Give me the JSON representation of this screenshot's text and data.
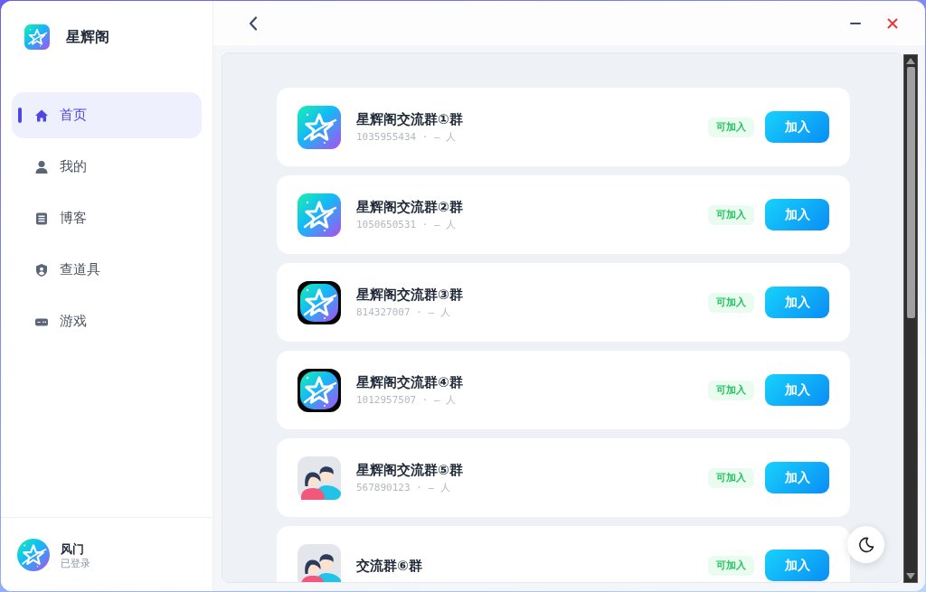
{
  "app": {
    "title": "星辉阁"
  },
  "nav": [
    {
      "label": "首页",
      "kind": "home",
      "selected": true
    },
    {
      "label": "我的",
      "kind": "person",
      "selected": false
    },
    {
      "label": "博客",
      "kind": "document",
      "selected": false
    },
    {
      "label": "查道具",
      "kind": "shield",
      "selected": false
    },
    {
      "label": "游戏",
      "kind": "gamepad",
      "selected": false
    }
  ],
  "user": {
    "name": "风门",
    "status": "已登录"
  },
  "groups": [
    {
      "name": "星辉阁交流群①群",
      "meta": "1035955434 · — 人",
      "kind": "star",
      "badge": "可加入",
      "action": "加入"
    },
    {
      "name": "星辉阁交流群②群",
      "meta": "1050650531 · — 人",
      "kind": "star",
      "badge": "可加入",
      "action": "加入"
    },
    {
      "name": "星辉阁交流群③群",
      "meta": "814327007 · — 人",
      "kind": "star-dark",
      "badge": "可加入",
      "action": "加入"
    },
    {
      "name": "星辉阁交流群④群",
      "meta": "1012957507 · — 人",
      "kind": "star-dark",
      "badge": "可加入",
      "action": "加入"
    },
    {
      "name": "星辉阁交流群⑤群",
      "meta": "567890123 · — 人",
      "kind": "people",
      "badge": "可加入",
      "action": "加入"
    },
    {
      "name": "交流群⑥群",
      "kind": "people",
      "badge": "可加入",
      "action": "加入"
    }
  ]
}
